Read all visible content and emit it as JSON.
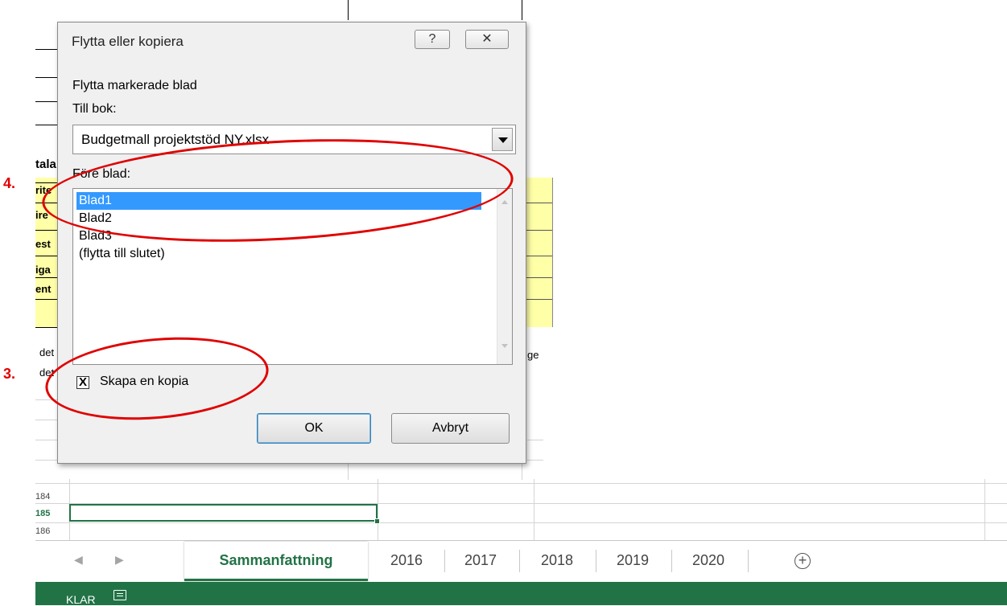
{
  "sheet_fragments": {
    "heading": "tala",
    "rows": [
      "rite",
      "ire",
      "est",
      "iga",
      "ent"
    ],
    "note_line1": "det",
    "note_line2": "det",
    "right_fragment": "ge"
  },
  "row_headers": [
    "184",
    "185",
    "186"
  ],
  "sheet_tabs": {
    "nav_prev": "◀",
    "nav_next": "▶",
    "tabs": [
      "Sammanfattning",
      "2016",
      "2017",
      "2018",
      "2019",
      "2020"
    ],
    "add": "+"
  },
  "status_bar": {
    "mode": "KLAR"
  },
  "dialog": {
    "title": "Flytta eller kopiera",
    "help_glyph": "?",
    "close_glyph": "✕",
    "heading": "Flytta markerade blad",
    "to_book_label": "Till bok:",
    "to_book_value": "Budgetmall projektstöd NY.xlsx",
    "before_sheet_label": "Före blad:",
    "sheets": [
      "Blad1",
      "Blad2",
      "Blad3",
      "(flytta till slutet)"
    ],
    "selected_sheet": "Blad1",
    "create_copy_label": "Skapa en kopia",
    "create_copy_checked": true,
    "check_glyph": "X",
    "ok_label": "OK",
    "cancel_label": "Avbryt"
  },
  "annotations": {
    "step4": "4.",
    "step3": "3."
  },
  "colors": {
    "excel_green": "#217346",
    "selection_blue": "#3399ff",
    "highlight_yellow": "#ffffa8",
    "annotation_red": "#e00000"
  }
}
